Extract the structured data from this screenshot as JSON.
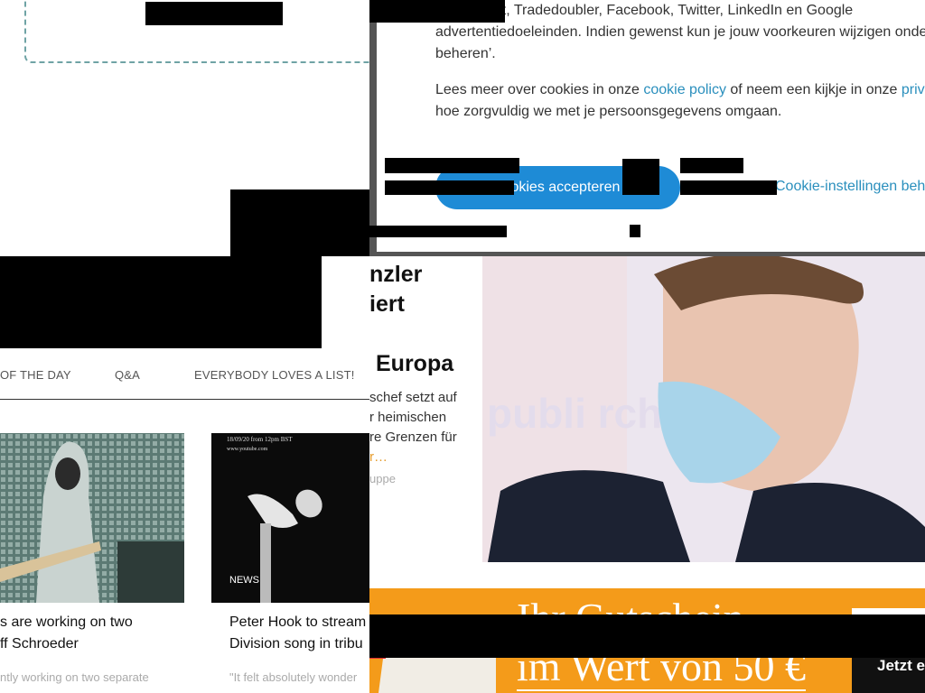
{
  "cookie": {
    "line1": "n Microsoft, Tradedoubler, Facebook, Twitter, LinkedIn en Google",
    "line2": "advertentiedoeleinden. Indien gewenst kun je jouw voorkeuren wijzigen onder",
    "line3": "beheren’.",
    "more_prefix": "Lees meer over cookies in onze ",
    "policy_link": "cookie policy",
    "more_mid": " of neem een kijkje in onze ",
    "privacy_link": "priv",
    "more_line2": "hoe zorgvuldig we met je persoonsgegevens omgaan.",
    "accept_label": "cookies accepteren",
    "manage_label": "Cookie-instellingen beheren"
  },
  "nav": {
    "items": [
      "OF THE DAY",
      "Q&A",
      "EVERYBODY LOVES A LIST!"
    ]
  },
  "cards": [
    {
      "title_line1": "s are working on two",
      "title_line2": "ff Schroeder",
      "subtitle": "ntly working on two separate"
    },
    {
      "badge": "NEWS",
      "poster_text": "18/09/20 from 12pm BST\nwww.youtube.com",
      "title_line1": "Peter Hook to stream",
      "title_line2": "Division song in tribu",
      "subtitle": "\"It felt absolutely wonder"
    }
  ],
  "article": {
    "headline_line1": "nzler",
    "headline_line2": "iert",
    "headline_line3": "Europa",
    "teaser_line1": "schef setzt auf",
    "teaser_line2": "r heimischen",
    "teaser_line3": "re Grenzen für",
    "teaser_more": "r…",
    "source": "uppe",
    "photo_watermark": "publi        rch"
  },
  "ad": {
    "top_text": "Ihr Gutschein",
    "big_text": "im Wert von 50 €",
    "button_label": "Jetzt e"
  }
}
